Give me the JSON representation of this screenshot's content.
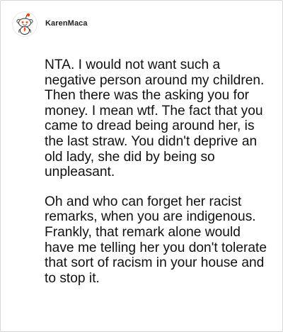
{
  "comment": {
    "author": {
      "name": "KarenMaca",
      "avatar_icon": "reddit-snoo-avatar-icon"
    },
    "paragraphs": [
      "NTA. I would not want such a negative person around my children. Then there was the asking you for money. I mean wtf. The fact that you came to dread being around her, is the last straw. You didn't deprive an old lady, she did by being so unpleasant.",
      "Oh and who can forget her racist remarks, when you are indigenous. Frankly, that remark alone would have me telling her you don't tolerate that sort of racism in your house and to stop it."
    ]
  },
  "colors": {
    "background": "#ffffff",
    "border": "#d9d9d9",
    "text": "#111111",
    "snoo_accent": "#ff4500"
  }
}
